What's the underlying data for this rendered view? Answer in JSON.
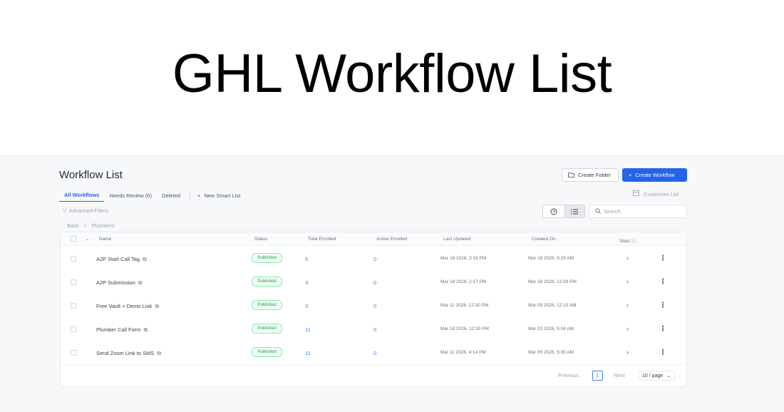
{
  "banner": {
    "title": "GHL Workflow List"
  },
  "page": {
    "title": "Workflow List"
  },
  "actions": {
    "create_folder": "Create Folder",
    "create_workflow": "Create Workflow"
  },
  "tabs": [
    {
      "label": "All Workflows",
      "active": true
    },
    {
      "label": "Needs Review (0)",
      "active": false
    },
    {
      "label": "Deleted",
      "active": false
    }
  ],
  "new_smart_list": "New Smart List",
  "customize_list": "Customize List",
  "advanced_filters": "Advanced Filters",
  "search": {
    "placeholder": "Search",
    "value": ""
  },
  "breadcrumb": {
    "back": "Back",
    "separator": "/",
    "current": "Plumbers"
  },
  "table": {
    "columns": [
      "Name",
      "Status",
      "Total Enrolled",
      "Active Enrolled",
      "Last Updated",
      "Created On",
      "Stats"
    ],
    "rows": [
      {
        "name": "A2P Start Call Tag",
        "status": "Published",
        "total": "5",
        "active": "0",
        "updated": "Mar 18 2026, 2:16 PM",
        "created": "Mar 18 2026, 8:28 AM"
      },
      {
        "name": "A2P Submission",
        "status": "Published",
        "total": "3",
        "active": "0",
        "updated": "Mar 18 2026, 2:17 PM",
        "created": "Mar 18 2026, 12:39 PM"
      },
      {
        "name": "Free Vault + Demo Link",
        "status": "Published",
        "total": "3",
        "active": "0",
        "updated": "Mar 11 2026, 12:30 PM",
        "created": "Mar 09 2026, 12:15 AM"
      },
      {
        "name": "Plumber Call Form",
        "status": "Published",
        "total": "11",
        "active": "0",
        "updated": "Mar 18 2026, 12:30 PM",
        "created": "Mar 02 2026, 5:04 AM"
      },
      {
        "name": "Send Zoom Link to SMS",
        "status": "Published",
        "total": "11",
        "active": "0",
        "updated": "Mar 11 2026, 4:14 PM",
        "created": "Mar 09 2026, 5:35 AM"
      }
    ]
  },
  "pagination": {
    "previous": "Previous",
    "page": "1",
    "next": "Next",
    "page_size": "10 / page"
  },
  "colors": {
    "accent": "#2563eb",
    "published_text": "#16a34a",
    "published_border": "#86efac"
  }
}
